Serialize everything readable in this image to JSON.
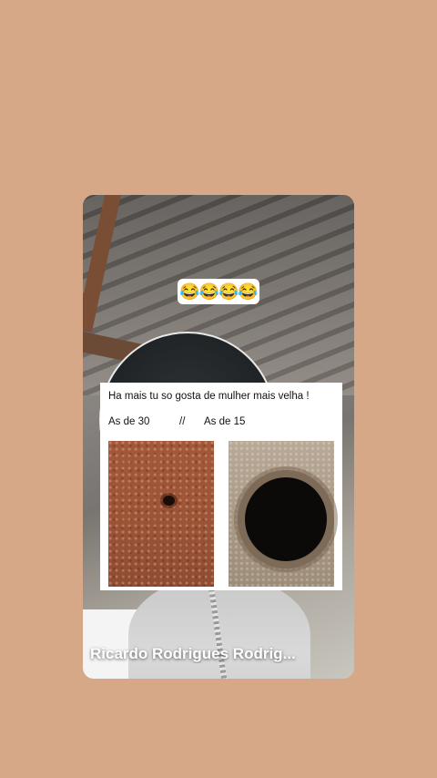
{
  "story": {
    "emoji_sticker": "😂😂😂😂",
    "meme": {
      "caption": "Ha mais tu so gosta de mulher mais velha !",
      "left_label": "As de 30",
      "separator": "//",
      "right_label": "As de 15"
    },
    "username": "Ricardo Rodrigues Rodrig..."
  },
  "colors": {
    "background": "#d6a887",
    "meme_card": "#ffffff",
    "username_text": "#ffffff"
  }
}
